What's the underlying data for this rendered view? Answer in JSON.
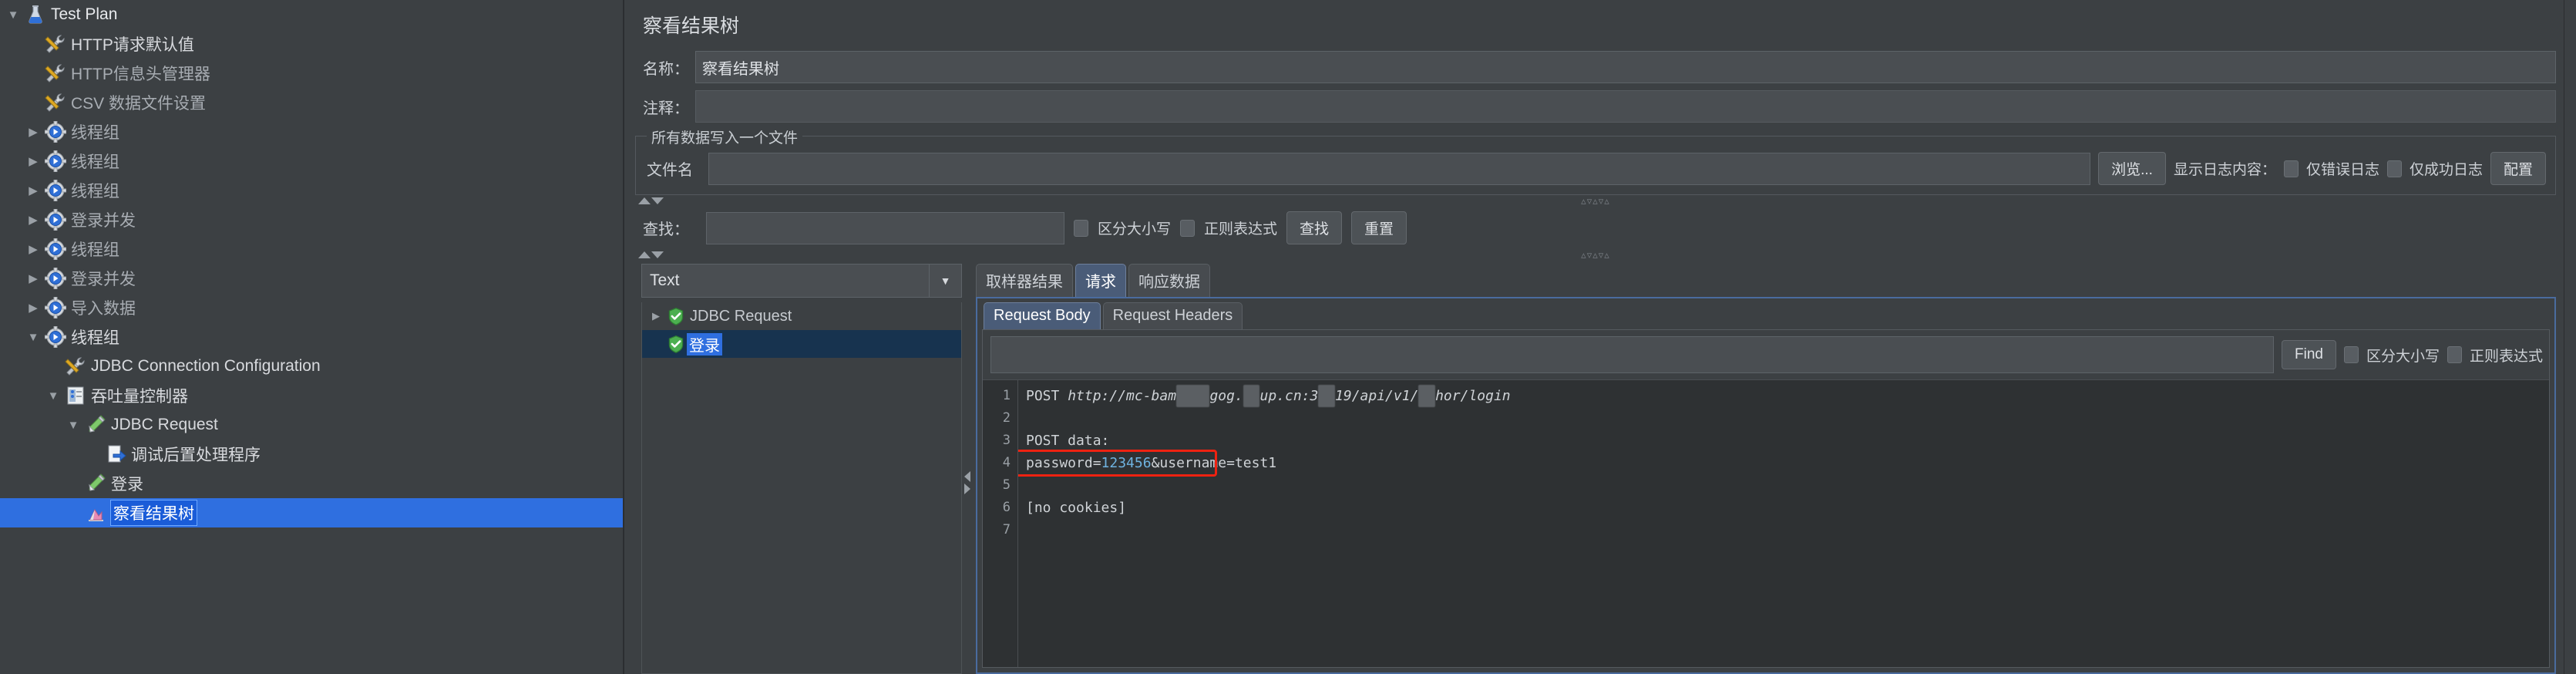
{
  "tree": {
    "name": "test-plan-tree",
    "items": [
      {
        "label": "Test Plan",
        "icon": "flask-icon",
        "indent": 0,
        "toggle": "expanded",
        "style": "white"
      },
      {
        "label": "HTTP请求默认值",
        "icon": "wrench-icon",
        "indent": 1,
        "toggle": "none",
        "style": "bright"
      },
      {
        "label": "HTTP信息头管理器",
        "icon": "wrench-icon",
        "indent": 1,
        "toggle": "none",
        "style": "dim"
      },
      {
        "label": "CSV 数据文件设置",
        "icon": "wrench-icon",
        "indent": 1,
        "toggle": "none",
        "style": "dim"
      },
      {
        "label": "线程组",
        "icon": "gear-icon",
        "indent": 1,
        "toggle": "collapsed",
        "style": "dim"
      },
      {
        "label": "线程组",
        "icon": "gear-icon",
        "indent": 1,
        "toggle": "collapsed",
        "style": "dim"
      },
      {
        "label": "线程组",
        "icon": "gear-icon",
        "indent": 1,
        "toggle": "collapsed",
        "style": "dim"
      },
      {
        "label": "登录并发",
        "icon": "gear-icon",
        "indent": 1,
        "toggle": "collapsed",
        "style": "dim"
      },
      {
        "label": "线程组",
        "icon": "gear-icon",
        "indent": 1,
        "toggle": "collapsed",
        "style": "dim"
      },
      {
        "label": "登录并发",
        "icon": "gear-icon",
        "indent": 1,
        "toggle": "collapsed",
        "style": "dim"
      },
      {
        "label": "导入数据",
        "icon": "gear-icon",
        "indent": 1,
        "toggle": "collapsed",
        "style": "dim"
      },
      {
        "label": "线程组",
        "icon": "gear-icon",
        "indent": 1,
        "toggle": "expanded",
        "style": "bright"
      },
      {
        "label": "JDBC Connection Configuration",
        "icon": "wrench-icon",
        "indent": 2,
        "toggle": "none",
        "style": "bright"
      },
      {
        "label": "吞吐量控制器",
        "icon": "controller-icon",
        "indent": 2,
        "toggle": "expanded",
        "style": "bright"
      },
      {
        "label": "JDBC Request",
        "icon": "pencil-icon",
        "indent": 3,
        "toggle": "expanded",
        "style": "bright"
      },
      {
        "label": "调试后置处理程序",
        "icon": "post-processor-icon",
        "indent": 4,
        "toggle": "none",
        "style": "bright"
      },
      {
        "label": "登录",
        "icon": "pencil-icon",
        "indent": 3,
        "toggle": "none",
        "style": "bright"
      },
      {
        "label": "察看结果树",
        "icon": "chart-icon",
        "indent": 3,
        "toggle": "none",
        "style": "selected",
        "selected": true
      }
    ]
  },
  "panel": {
    "title": "察看结果树",
    "name_label": "名称：",
    "name_value": "察看结果树",
    "comment_label": "注释：",
    "comment_value": "",
    "group": {
      "title": "所有数据写入一个文件",
      "filename_label": "文件名",
      "filename_value": "",
      "browse_label": "浏览...",
      "log_display_label": "显示日志内容：",
      "error_only_label": "仅错误日志",
      "error_only_checked": false,
      "success_only_label": "仅成功日志",
      "success_only_checked": false,
      "configure_label": "配置"
    },
    "search": {
      "label": "查找：",
      "value": "",
      "case_sensitive_label": "区分大小写",
      "case_sensitive_checked": false,
      "regex_label": "正则表达式",
      "regex_checked": false,
      "find_button": "查找",
      "reset_button": "重置"
    },
    "splitter_dots": "▵▿▵▿▵"
  },
  "results": {
    "renderer_selected": "Text",
    "tree": [
      {
        "label": "JDBC Request",
        "icon": "shield-success-icon",
        "toggle": "collapsed",
        "selected": false
      },
      {
        "label": "登录",
        "icon": "shield-success-icon",
        "toggle": "none",
        "selected": true
      }
    ]
  },
  "tabs": {
    "main": [
      {
        "label": "取样器结果",
        "active": false
      },
      {
        "label": "请求",
        "active": true
      },
      {
        "label": "响应数据",
        "active": false
      }
    ],
    "sub": [
      {
        "label": "Request Body",
        "active": true
      },
      {
        "label": "Request Headers",
        "active": false
      }
    ]
  },
  "find_bar": {
    "value": "",
    "find_label": "Find",
    "case_sensitive_label": "区分大小写",
    "case_sensitive_checked": false,
    "regex_label": "正则表达式",
    "regex_checked": false
  },
  "code": {
    "lines": [
      {
        "n": "1",
        "segments": [
          {
            "t": "POST ",
            "c": "kw"
          },
          {
            "t": "http://mc-bam",
            "c": "url"
          },
          {
            "t": "xxxx",
            "c": "redact"
          },
          {
            "t": "gog.",
            "c": "url"
          },
          {
            "t": "xx",
            "c": "redact"
          },
          {
            "t": "up.cn:3",
            "c": "url"
          },
          {
            "t": "xx",
            "c": "redact"
          },
          {
            "t": "19/api/v1/",
            "c": "url"
          },
          {
            "t": "xx",
            "c": "redact"
          },
          {
            "t": "hor/login",
            "c": "url"
          }
        ]
      },
      {
        "n": "2",
        "segments": []
      },
      {
        "n": "3",
        "segments": [
          {
            "t": "POST data:",
            "c": "kw"
          }
        ]
      },
      {
        "n": "4",
        "segments": [
          {
            "t": "password=",
            "c": "kw"
          },
          {
            "t": "123456",
            "c": "num"
          },
          {
            "t": "&username=test1",
            "c": "kw"
          }
        ]
      },
      {
        "n": "5",
        "segments": []
      },
      {
        "n": "6",
        "segments": [
          {
            "t": "[no cookies]",
            "c": "kw"
          }
        ]
      },
      {
        "n": "7",
        "segments": []
      }
    ],
    "highlight": {
      "line": 4,
      "color": "#ee2211"
    }
  },
  "colors": {
    "window_bg": "#3c4043",
    "selection_blue": "#2f6fe0",
    "tab_active_blue": "#4a5c78",
    "panel_border_blue": "#4a6b9e",
    "editor_bg": "#2e3133",
    "highlight_red": "#ee2211",
    "number_blue": "#6fb3e0"
  }
}
